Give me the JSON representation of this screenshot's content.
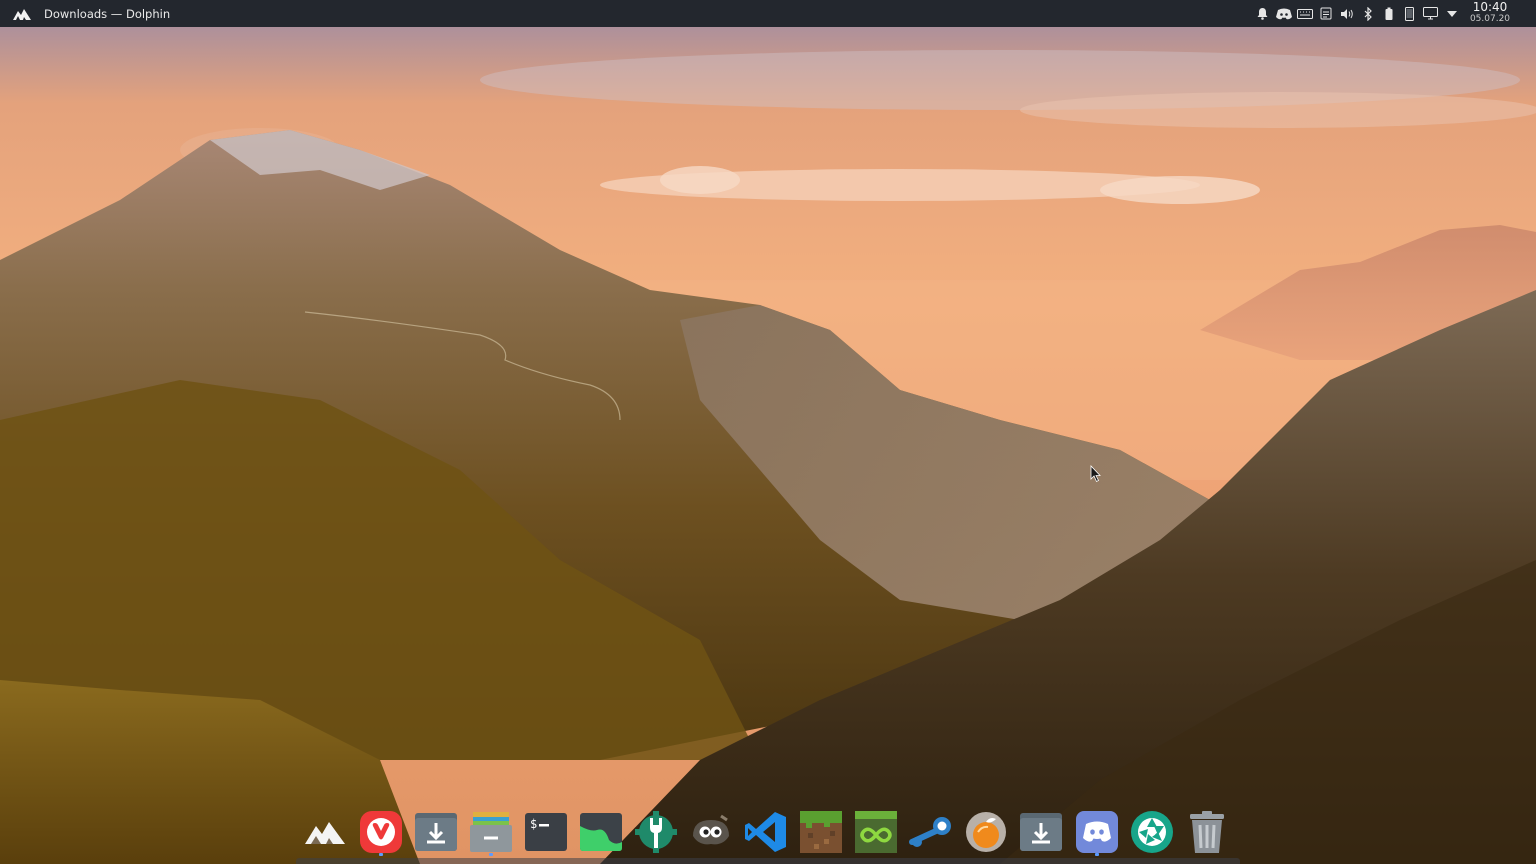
{
  "top_panel": {
    "window_title": "Downloads — Dolphin",
    "tray_icons": [
      "notifications-icon",
      "discord-tray-icon",
      "keyboard-icon",
      "clipboard-icon",
      "volume-icon",
      "bluetooth-icon",
      "battery-icon",
      "phone-icon",
      "display-icon",
      "expand-tray-icon"
    ],
    "clock": {
      "time": "10:40",
      "date": "05.07.20"
    }
  },
  "dock": {
    "items": [
      {
        "name": "app-launcher",
        "icon": "mountain-logo-icon"
      },
      {
        "name": "vivaldi",
        "icon": "vivaldi-icon"
      },
      {
        "name": "downloads",
        "icon": "download-folder-icon"
      },
      {
        "name": "archive-manager",
        "icon": "archive-icon"
      },
      {
        "name": "terminal",
        "icon": "terminal-icon"
      },
      {
        "name": "system-monitor",
        "icon": "system-monitor-icon"
      },
      {
        "name": "settings",
        "icon": "wrench-gear-icon"
      },
      {
        "name": "gimp",
        "icon": "gimp-icon"
      },
      {
        "name": "vscode",
        "icon": "vscode-icon"
      },
      {
        "name": "minecraft",
        "icon": "minecraft-icon"
      },
      {
        "name": "loop-app",
        "icon": "infinity-icon"
      },
      {
        "name": "steam",
        "icon": "steam-icon"
      },
      {
        "name": "tomato-timer",
        "icon": "orange-icon"
      },
      {
        "name": "downloads-2",
        "icon": "download-folder-icon"
      },
      {
        "name": "discord",
        "icon": "discord-icon"
      },
      {
        "name": "camera-app",
        "icon": "aperture-icon"
      },
      {
        "name": "trash",
        "icon": "trash-icon"
      }
    ]
  },
  "colors": {
    "panel_bg": "#23272e",
    "accent": "#5b9bff",
    "vivaldi_red": "#ef3939",
    "folder_grey": "#5a6872",
    "discord_blue": "#7289da",
    "vscode_blue": "#1e8ae6"
  }
}
